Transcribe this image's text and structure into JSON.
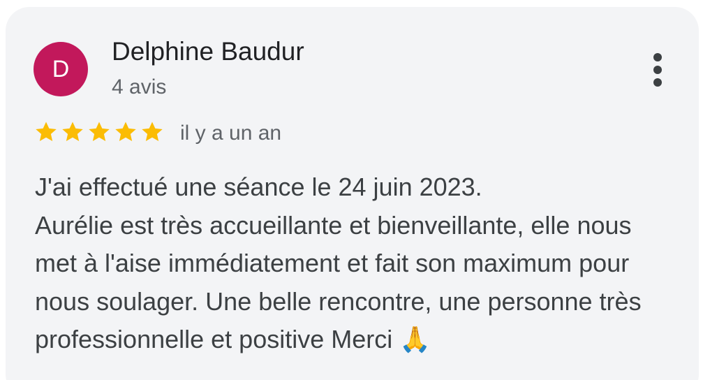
{
  "review": {
    "avatar_letter": "D",
    "avatar_color": "#c2185b",
    "author_name": "Delphine Baudur",
    "review_count": "4 avis",
    "rating": 5,
    "rating_max": 5,
    "time_ago": "il y a un an",
    "text": "J'ai effectué une séance le 24 juin 2023.\nAurélie est très accueillante et bienveillante, elle nous\nmet à l'aise immédiatement et fait son maximum pour\nnous soulager. Une belle rencontre, une personne très\nprofessionnelle et positive Merci 🙏",
    "more_icon": "more-vert-icon",
    "star_icon": "star-icon",
    "star_color": "#fbbc04"
  }
}
